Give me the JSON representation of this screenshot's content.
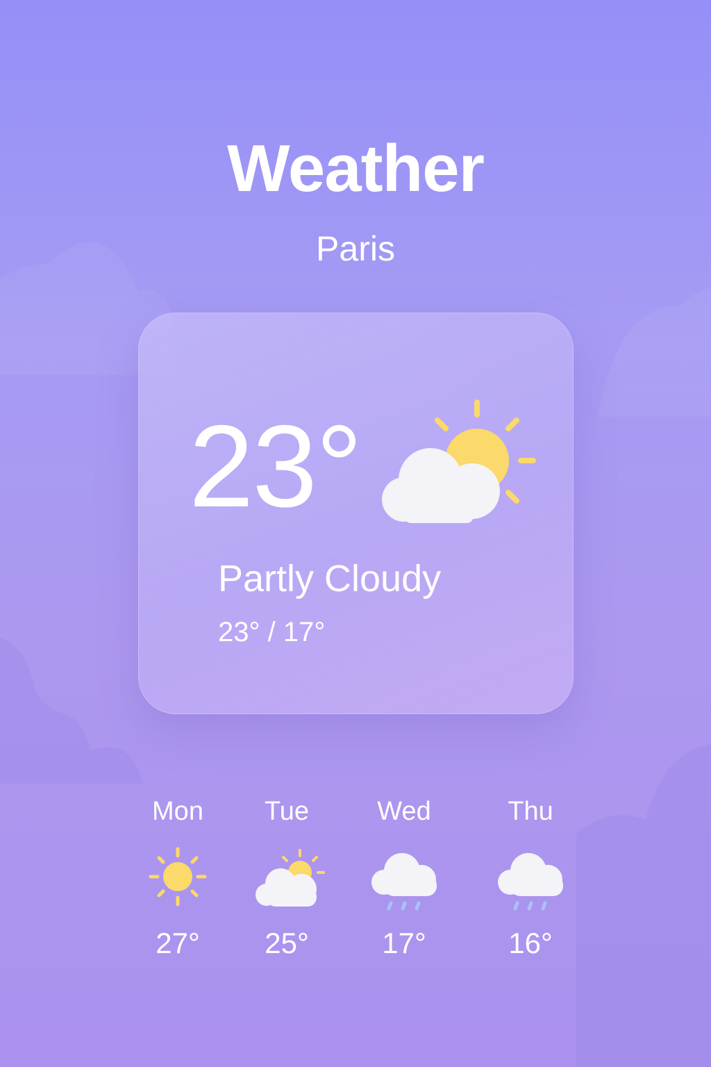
{
  "header": {
    "title": "Weather",
    "city": "Paris"
  },
  "current": {
    "temperature": "23°",
    "condition": "Partly Cloudy",
    "high_low": "23° / 17°",
    "icon": "partly-cloudy-icon"
  },
  "forecast": [
    {
      "day": "Mon",
      "temp": "27°",
      "icon": "sun-icon"
    },
    {
      "day": "Tue",
      "temp": "25°",
      "icon": "partly-cloudy-icon"
    },
    {
      "day": "Wed",
      "temp": "17°",
      "icon": "rain-cloud-icon"
    },
    {
      "day": "Thu",
      "temp": "16°",
      "icon": "rain-cloud-icon"
    }
  ],
  "colors": {
    "background_top": "#9490f7",
    "background_bottom": "#aa92ee",
    "sun": "#fbd96a",
    "cloud": "#f3f3f8",
    "rain": "#a9c2f5",
    "text": "#ffffff"
  }
}
